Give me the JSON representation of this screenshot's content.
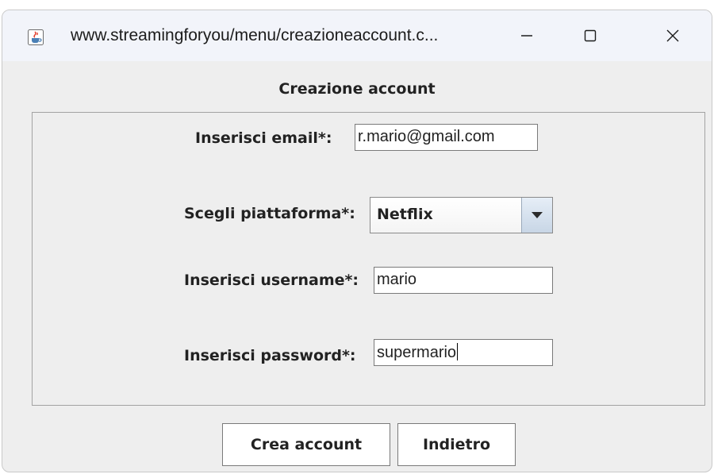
{
  "window": {
    "title": "www.streamingforyou/menu/creazioneaccount.c...",
    "app_icon": "java-cup-icon",
    "controls": {
      "minimize": "minimize-icon",
      "maximize": "maximize-icon",
      "close": "close-icon"
    }
  },
  "heading": "Creazione account",
  "form": {
    "email": {
      "label": "Inserisci email*:",
      "value": "r.mario@gmail.com"
    },
    "platform": {
      "label": "Scegli piattaforma*:",
      "value": "Netflix",
      "icon": "chevron-down-icon"
    },
    "username": {
      "label": "Inserisci username*:",
      "value": "mario"
    },
    "password": {
      "label": "Inserisci password*:",
      "value": "supermario"
    }
  },
  "buttons": {
    "create": "Crea account",
    "back": "Indietro"
  },
  "colors": {
    "titlebar": "#f2f4fa",
    "window_bg": "#eeeeee",
    "combo_arrow": "#c8d6e6"
  }
}
